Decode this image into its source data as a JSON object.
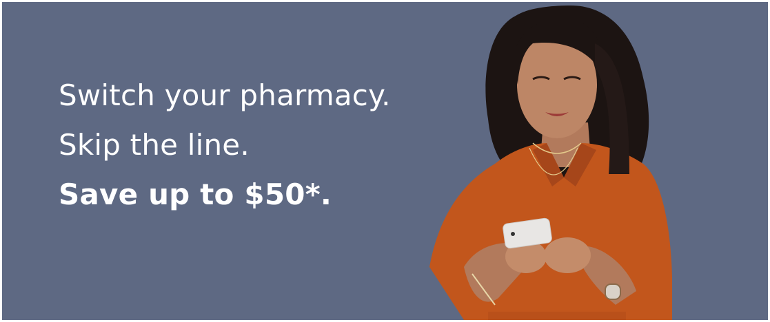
{
  "banner": {
    "line1": "Switch your pharmacy.",
    "line2": "Skip the line.",
    "line3": "Save up to $50*."
  },
  "colors": {
    "background": "#5e6983",
    "text": "#ffffff",
    "shirt": "#c2561c",
    "hair": "#1c1412",
    "skin": "#b98262"
  },
  "photo": {
    "subject": "woman-with-phone"
  }
}
